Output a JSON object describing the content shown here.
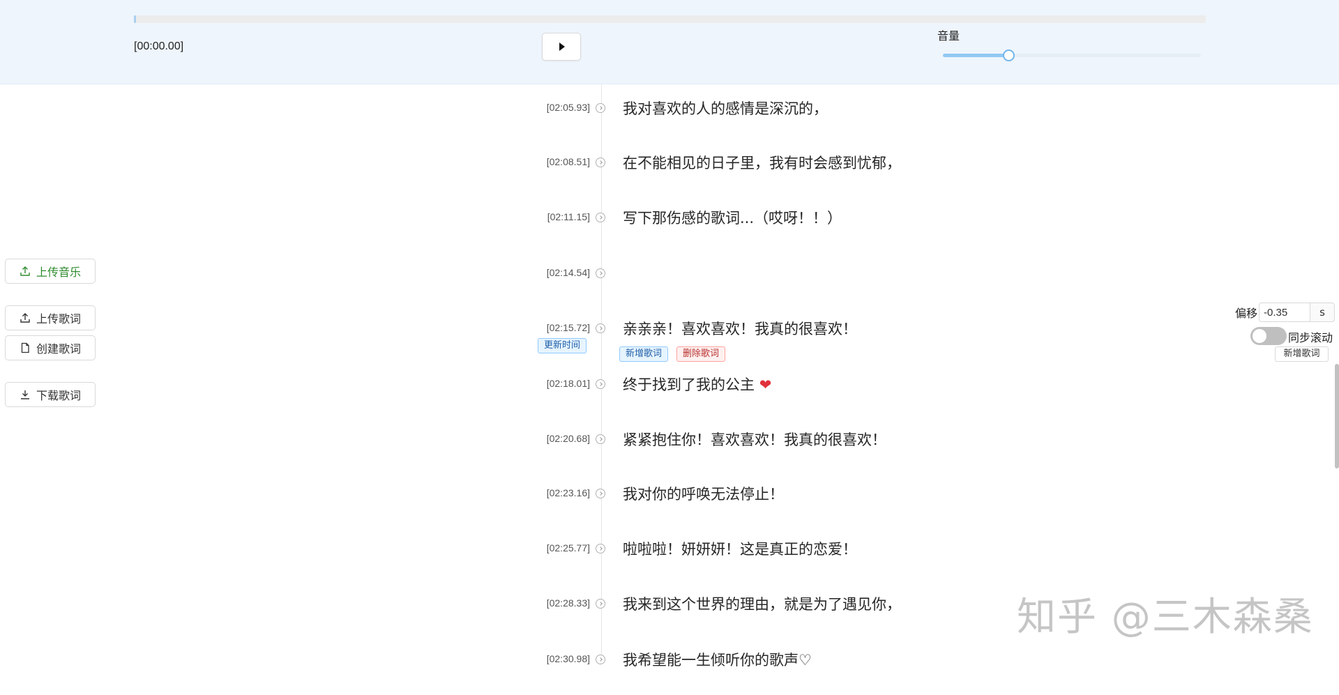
{
  "player": {
    "current_time": "[00:00.00]",
    "progress": 0.001,
    "volume_label": "音量",
    "volume": 0.25
  },
  "sidebar": {
    "upload_music": "上传音乐",
    "upload_lyrics": "上传歌词",
    "create_lyrics": "创建歌词",
    "download_lyrics": "下载歌词"
  },
  "lyrics": [
    {
      "time": "[02:05.93]",
      "text": "我对喜欢的人的感情是深沉的，"
    },
    {
      "time": "[02:08.51]",
      "text": "在不能相见的日子里，我有时会感到忧郁，"
    },
    {
      "time": "[02:11.15]",
      "text": "写下那伤感的歌词...（哎呀！！）"
    },
    {
      "time": "[02:14.54]",
      "text": ""
    },
    {
      "time": "[02:15.72]",
      "text": "亲亲亲！喜欢喜欢！我真的很喜欢！"
    },
    {
      "time": "[02:18.01]",
      "text": "终于找到了我的公主",
      "emoji": "❤"
    },
    {
      "time": "[02:20.68]",
      "text": "紧紧抱住你！喜欢喜欢！我真的很喜欢！"
    },
    {
      "time": "[02:23.16]",
      "text": "我对你的呼唤无法停止！"
    },
    {
      "time": "[02:25.77]",
      "text": "啦啦啦！妍妍妍！这是真正的恋爱！"
    },
    {
      "time": "[02:28.33]",
      "text": "我来到这个世界的理由，就是为了遇见你，"
    },
    {
      "time": "[02:30.98]",
      "text": "我希望能一生倾听你的歌声♡"
    }
  ],
  "active_row": {
    "update_time": "更新时间",
    "add_lyric": "新增歌词",
    "delete_lyric": "删除歌词"
  },
  "controls": {
    "offset_label": "偏移",
    "offset_value": "-0.35",
    "offset_unit": "s",
    "sync_scroll_label": "同步滚动",
    "sync_scroll_on": false,
    "add_lyric": "新增歌词"
  },
  "watermark": "知乎 @三木森桑",
  "colors": {
    "player_bg": "#eef5fc",
    "primary_green": "#2e8b2e",
    "accent_blue": "#91c9f2"
  }
}
